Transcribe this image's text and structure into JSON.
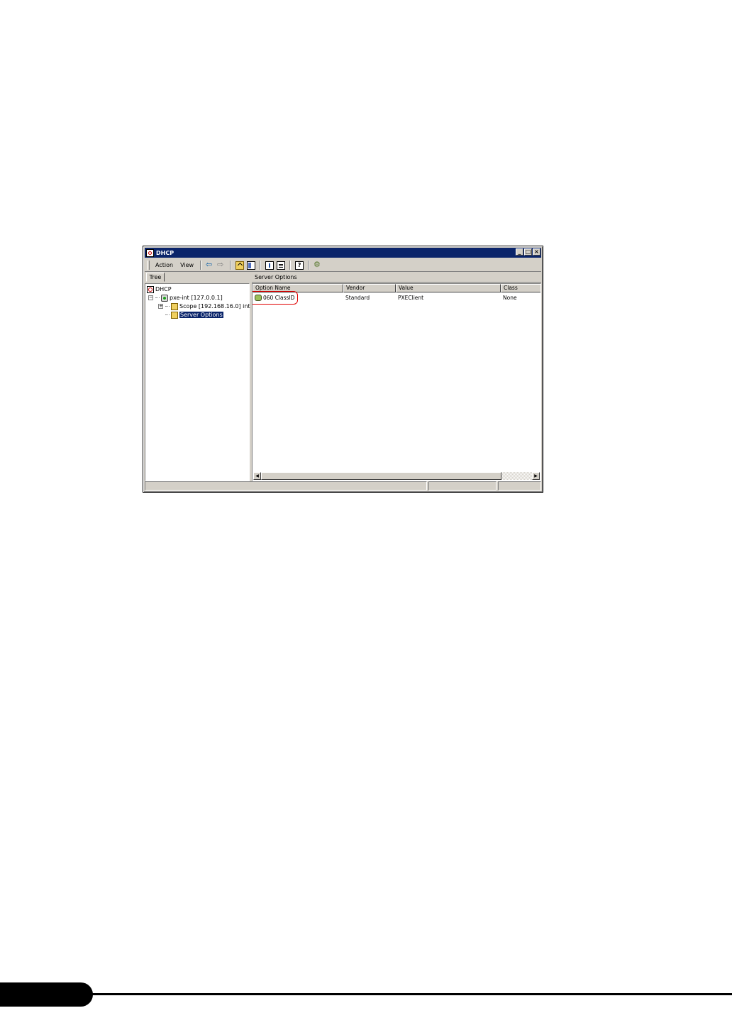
{
  "window": {
    "title": "DHCP",
    "controls": {
      "minimize": "_",
      "maximize": "□",
      "close": "×"
    }
  },
  "toolbar": {
    "menu_action": "Action",
    "menu_view": "View",
    "icons": [
      "back-icon",
      "forward-icon",
      "up-one-level-icon",
      "show-hide-tree-icon",
      "export-list-icon",
      "properties-icon",
      "help-icon",
      "refresh-icon"
    ]
  },
  "tree": {
    "tab_label": "Tree",
    "root": "DHCP",
    "server": "pxe-int [127.0.0.1]",
    "scope": "Scope [192.168.16.0] int",
    "server_options": "Server Options",
    "expander_server": "−",
    "expander_scope": "+"
  },
  "right_pane": {
    "header": "Server Options",
    "columns": [
      "Option Name",
      "Vendor",
      "Value",
      "Class"
    ],
    "rows": [
      {
        "option_name": "060 ClassID",
        "vendor": "Standard",
        "value": "PXEClient",
        "class": "None"
      }
    ],
    "scroll_left": "◀",
    "scroll_right": "▶"
  },
  "colors": {
    "titlebar": "#0a246a",
    "window_face": "#d4d0c8",
    "highlight_ring": "#e00000"
  }
}
